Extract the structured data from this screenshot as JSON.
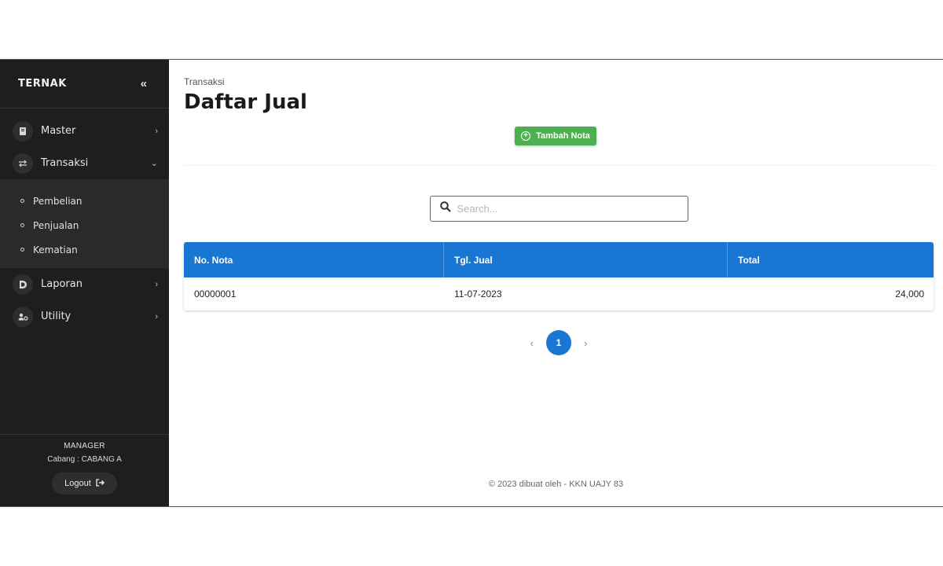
{
  "sidebar": {
    "brand": "TERNAK",
    "collapse_icon": "«",
    "items": [
      {
        "label": "Master",
        "icon": "book-icon",
        "caret": "›"
      },
      {
        "label": "Transaksi",
        "icon": "swap-icon",
        "caret": "⌄"
      },
      {
        "label": "Laporan",
        "icon": "report-icon",
        "caret": "›"
      },
      {
        "label": "Utility",
        "icon": "users-cog-icon",
        "caret": "›"
      }
    ],
    "submenu": [
      "Pembelian",
      "Penjualan",
      "Kematian"
    ],
    "footer": {
      "role": "MANAGER",
      "branch": "Cabang : CABANG A",
      "logout": "Logout"
    }
  },
  "main": {
    "breadcrumb": "Transaksi",
    "title": "Daftar Jual",
    "add_button": "Tambah Nota",
    "search": {
      "placeholder": "Search...",
      "value": ""
    },
    "table": {
      "headers": [
        "No. Nota",
        "Tgl. Jual",
        "Total"
      ],
      "rows": [
        [
          "00000001",
          "11-07-2023",
          "24,000"
        ]
      ]
    },
    "pagination": {
      "prev": "‹",
      "current": "1",
      "next": "›"
    },
    "footer": "© 2023 dibuat oleh - KKN UAJY 83"
  },
  "colors": {
    "sidebar_bg": "#1e1e1e",
    "primary": "#1976d2",
    "success": "#4caf50"
  }
}
